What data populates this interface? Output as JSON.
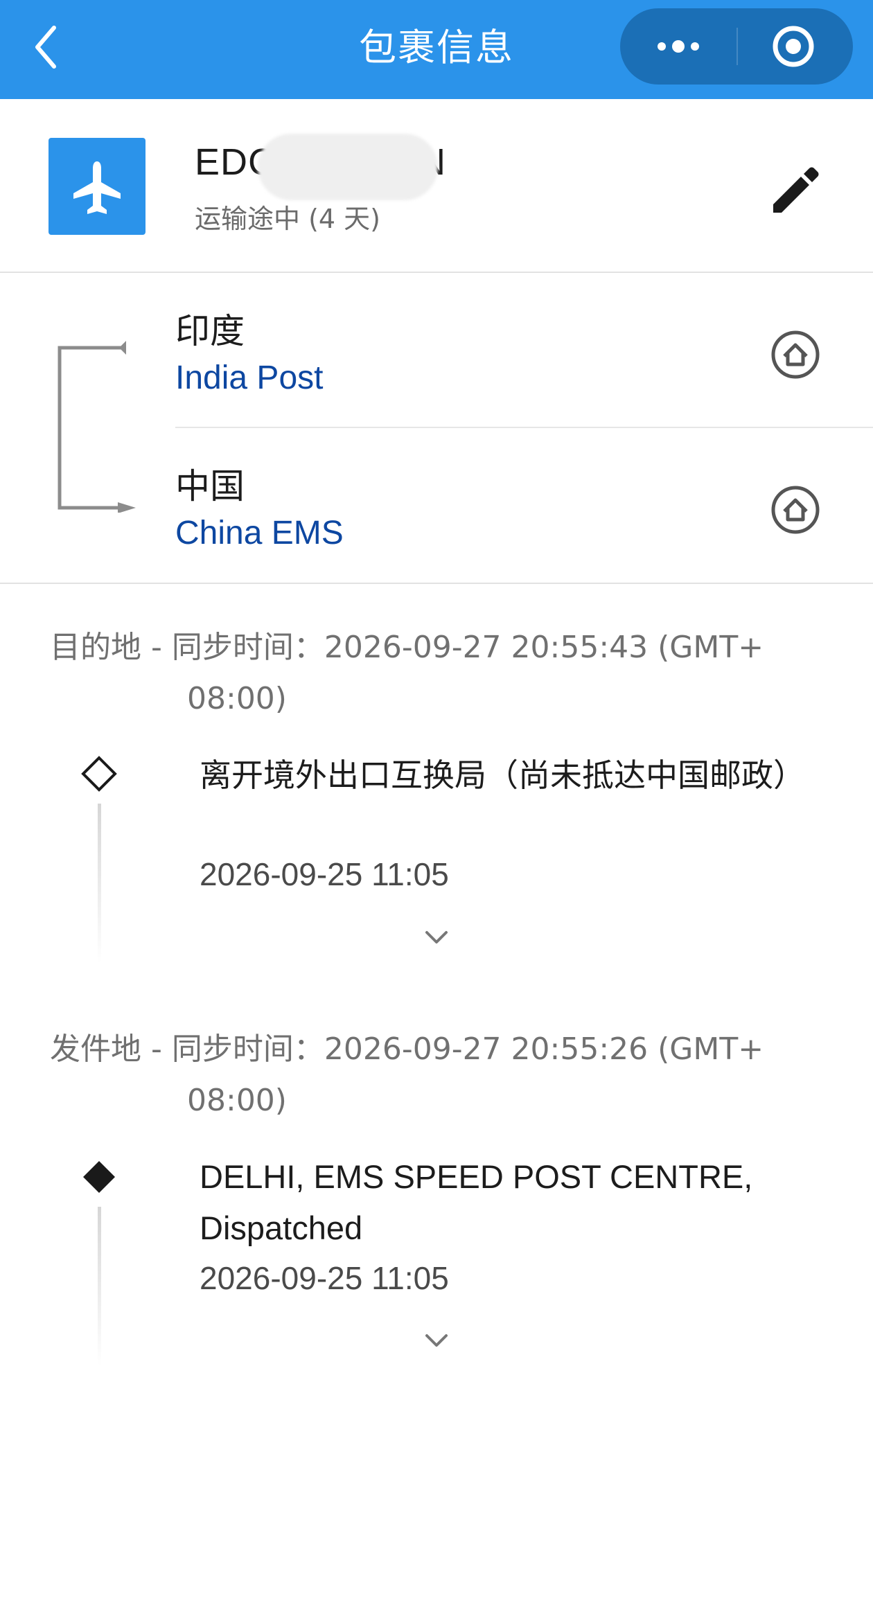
{
  "header": {
    "title": "包裹信息",
    "accent_color": "#2b93ea",
    "capsule_color": "#1b6fb6"
  },
  "package": {
    "tracking_prefix": "EDC",
    "tracking_suffix": "IN",
    "status": "运输途中 (4 天)",
    "icon": "airplane-icon"
  },
  "route": {
    "origin": {
      "country": "印度",
      "carrier": "India Post"
    },
    "destination": {
      "country": "中国",
      "carrier": "China EMS"
    }
  },
  "sections": [
    {
      "label": "目的地 - 同步时间：2026-09-27 20:55:43 (GMT+",
      "label_cont": "08:00)",
      "events": [
        {
          "text": "离开境外出口互换局（尚未抵达中国邮政）",
          "time": "2026-09-25 11:05",
          "marker": "hollow-diamond"
        }
      ]
    },
    {
      "label": "发件地 - 同步时间：2026-09-27 20:55:26 (GMT+",
      "label_cont": "08:00)",
      "events": [
        {
          "text": "DELHI, EMS SPEED POST CENTRE, Dispatched",
          "time": "2026-09-25 11:05",
          "marker": "filled-diamond"
        }
      ]
    }
  ]
}
